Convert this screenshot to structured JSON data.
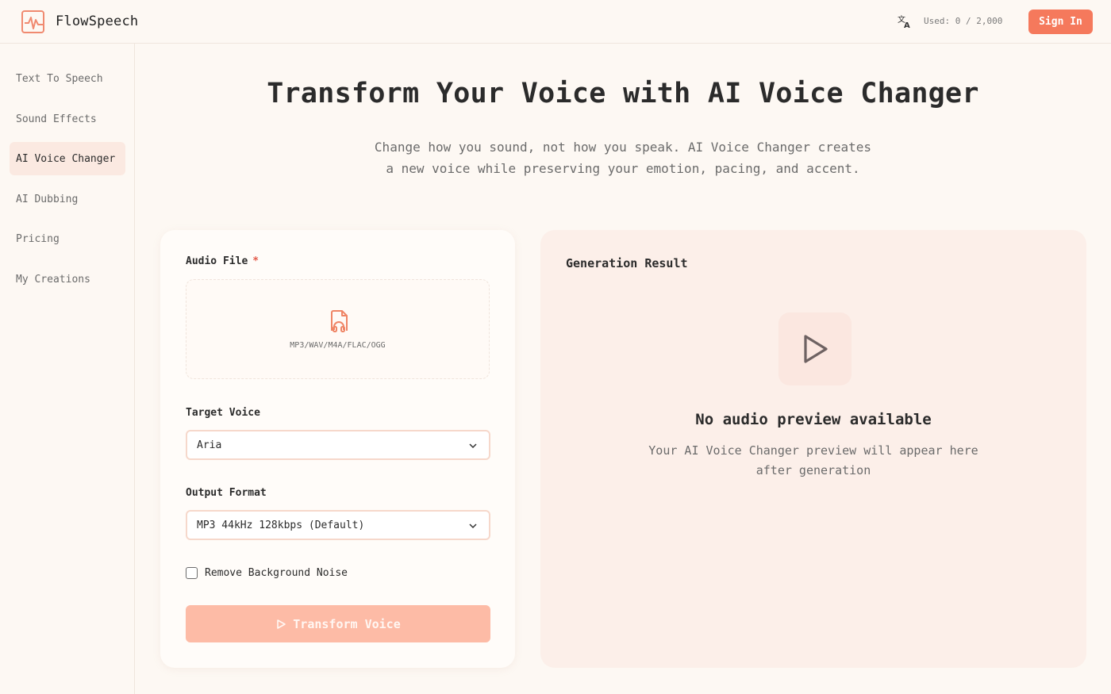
{
  "app": {
    "name": "FlowSpeech"
  },
  "header": {
    "usage": "Used: 0 / 2,000",
    "signin_label": "Sign In",
    "icons": [
      "translate-icon",
      "waveform-logo-icon"
    ]
  },
  "sidebar": {
    "items": [
      {
        "label": "Text To Speech"
      },
      {
        "label": "Sound Effects"
      },
      {
        "label": "AI Voice Changer",
        "active": true
      },
      {
        "label": "AI Dubbing"
      },
      {
        "label": "Pricing"
      },
      {
        "label": "My Creations"
      }
    ]
  },
  "hero": {
    "title": "Transform Your Voice with AI Voice Changer",
    "subtitle_line1": "Change how you sound, not how you speak. AI Voice Changer creates",
    "subtitle_line2": "a new voice while preserving your emotion, pacing, and accent."
  },
  "form": {
    "audio_label": "Audio File",
    "required_mark": "*",
    "formats": "MP3/WAV/M4A/FLAC/OGG",
    "voice_label": "Target Voice",
    "voice_value": "Aria",
    "format_label": "Output Format",
    "format_value": "MP3 44kHz 128kbps (Default)",
    "noise_label": "Remove Background Noise",
    "noise_checked": false,
    "submit_label": "Transform Voice"
  },
  "result": {
    "title": "Generation Result",
    "empty_title": "No audio preview available",
    "empty_desc_line1": "Your AI Voice Changer preview will appear here",
    "empty_desc_line2": "after generation"
  },
  "colors": {
    "accent": "#f5795c",
    "accent_disabled": "#fdbba6",
    "background": "#fdf8f3",
    "active_nav": "#fbe9e1",
    "result_bg": "#fcefe9"
  }
}
